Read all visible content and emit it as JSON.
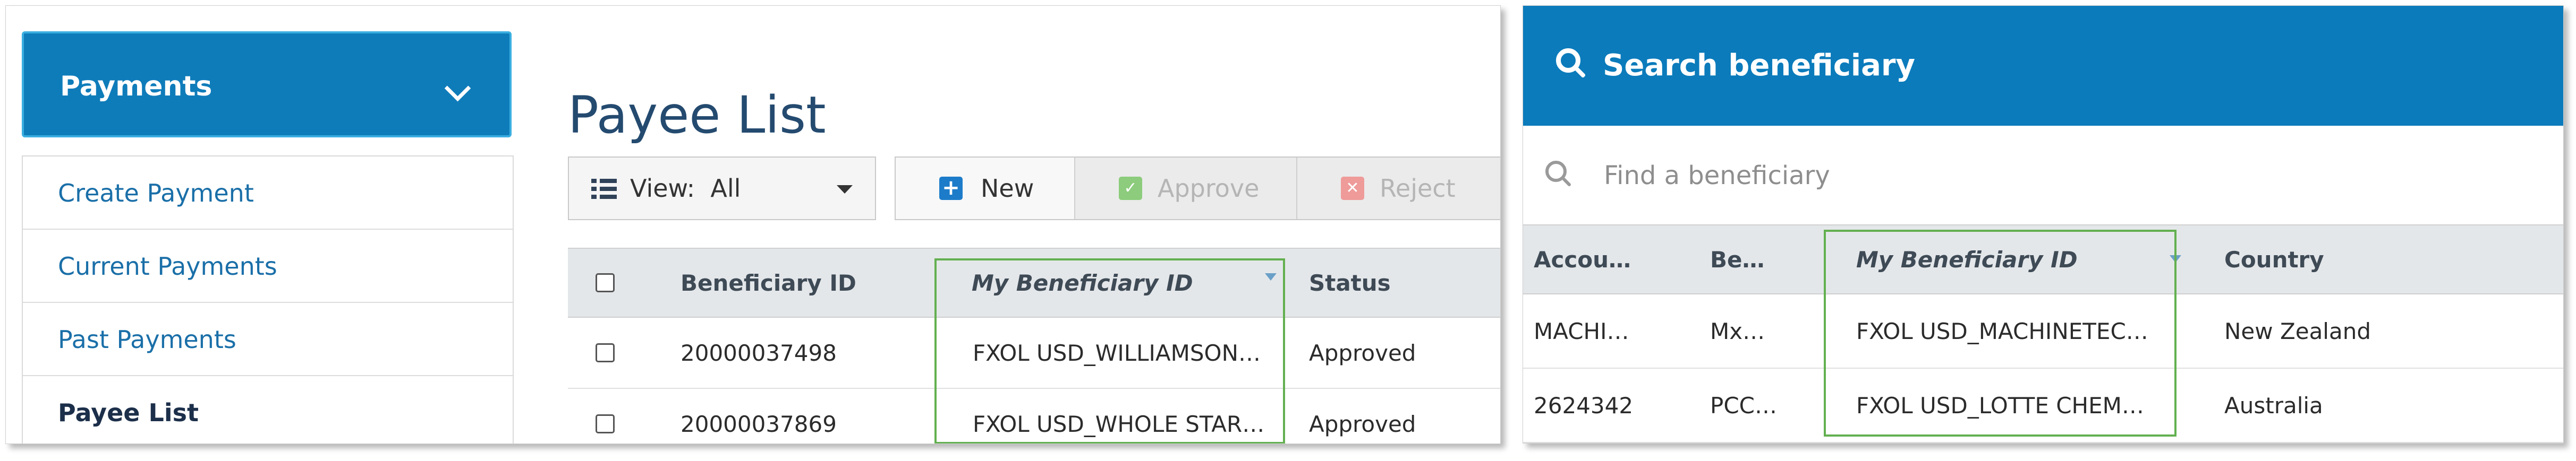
{
  "left": {
    "menu": {
      "title": "Payments",
      "chevron_icon": "chevron-down-icon"
    },
    "nav": [
      {
        "label": "Create Payment"
      },
      {
        "label": "Current Payments"
      },
      {
        "label": "Past Payments"
      },
      {
        "label": "Payee List",
        "active": true
      }
    ],
    "page_title": "Payee List",
    "toolbar": {
      "view_label": "View:",
      "view_value": "All",
      "new_label": "New",
      "approve_label": "Approve",
      "reject_label": "Reject"
    },
    "table": {
      "columns": [
        "Beneficiary ID",
        "My Beneficiary ID",
        "Status"
      ],
      "rows": [
        {
          "beneficiary_id": "20000037498",
          "my_beneficiary_id": "FXOL USD_WILLIAMSON…",
          "status": "Approved"
        },
        {
          "beneficiary_id": "20000037869",
          "my_beneficiary_id": "FXOL USD_WHOLE STAR…",
          "status": "Approved"
        }
      ]
    }
  },
  "right": {
    "header_title": "Search beneficiary",
    "search": {
      "placeholder": "Find a beneficiary",
      "value": ""
    },
    "table": {
      "columns": [
        "Accou…",
        "Be…",
        "My Beneficiary ID",
        "Country"
      ],
      "rows": [
        {
          "account": "MACHI…",
          "beneficiary": "Mx…",
          "my_beneficiary_id": "FXOL USD_MACHINETEC…",
          "country": "New Zealand"
        },
        {
          "account": "2624342",
          "beneficiary": "PCC…",
          "my_beneficiary_id": "FXOL USD_LOTTE CHEM…",
          "country": "Australia"
        }
      ]
    }
  },
  "colors": {
    "brand_blue": "#0f7cba",
    "highlight_green": "#63b050",
    "link_blue": "#1a6fa8",
    "title_navy": "#244a6f"
  }
}
